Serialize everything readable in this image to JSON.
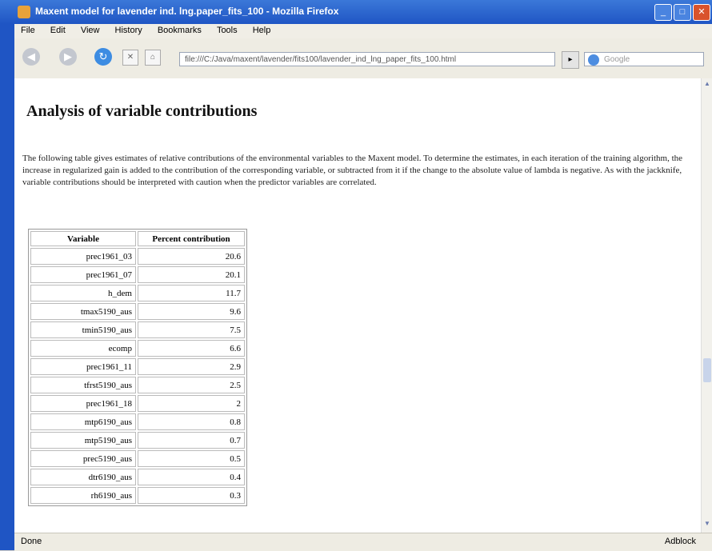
{
  "window": {
    "title": "Maxent model for lavender ind. lng.paper_fits_100 - Mozilla Firefox",
    "minimize_label": "_",
    "maximize_label": "□",
    "close_label": "✕"
  },
  "menu": [
    "File",
    "Edit",
    "View",
    "History",
    "Bookmarks",
    "Tools",
    "Help"
  ],
  "nav": {
    "back_icon": "back-arrow-icon",
    "forward_icon": "forward-arrow-icon",
    "url": "file:///C:/Java/maxent/lavender/fits100/lavender_ind_lng_paper_fits_100.html",
    "search_placeholder": "Google"
  },
  "page": {
    "heading": "Analysis of variable contributions",
    "description": "The following table gives estimates of relative contributions of the environmental variables to the Maxent model. To determine the estimates, in each iteration of the training algorithm, the increase in regularized gain is added to the contribution of the corresponding variable, or subtracted from it if the change to the absolute value of lambda is negative. As with the jackknife, variable contributions should be interpreted with caution when the predictor variables are correlated.",
    "table": {
      "headers": [
        "Variable",
        "Percent contribution"
      ],
      "rows": [
        [
          "prec1961_03",
          "20.6"
        ],
        [
          "prec1961_07",
          "20.1"
        ],
        [
          "h_dem",
          "11.7"
        ],
        [
          "tmax5190_aus",
          "9.6"
        ],
        [
          "tmin5190_aus",
          "7.5"
        ],
        [
          "ecomp",
          "6.6"
        ],
        [
          "prec1961_11",
          "2.9"
        ],
        [
          "tfrst5190_aus",
          "2.5"
        ],
        [
          "prec1961_18",
          "2"
        ],
        [
          "mtp6190_aus",
          "0.8"
        ],
        [
          "mtp5190_aus",
          "0.7"
        ],
        [
          "prec5190_aus",
          "0.5"
        ],
        [
          "dtr6190_aus",
          "0.4"
        ],
        [
          "rh6190_aus",
          "0.3"
        ]
      ]
    }
  },
  "status": {
    "left": "Done",
    "right": "Adblock"
  }
}
